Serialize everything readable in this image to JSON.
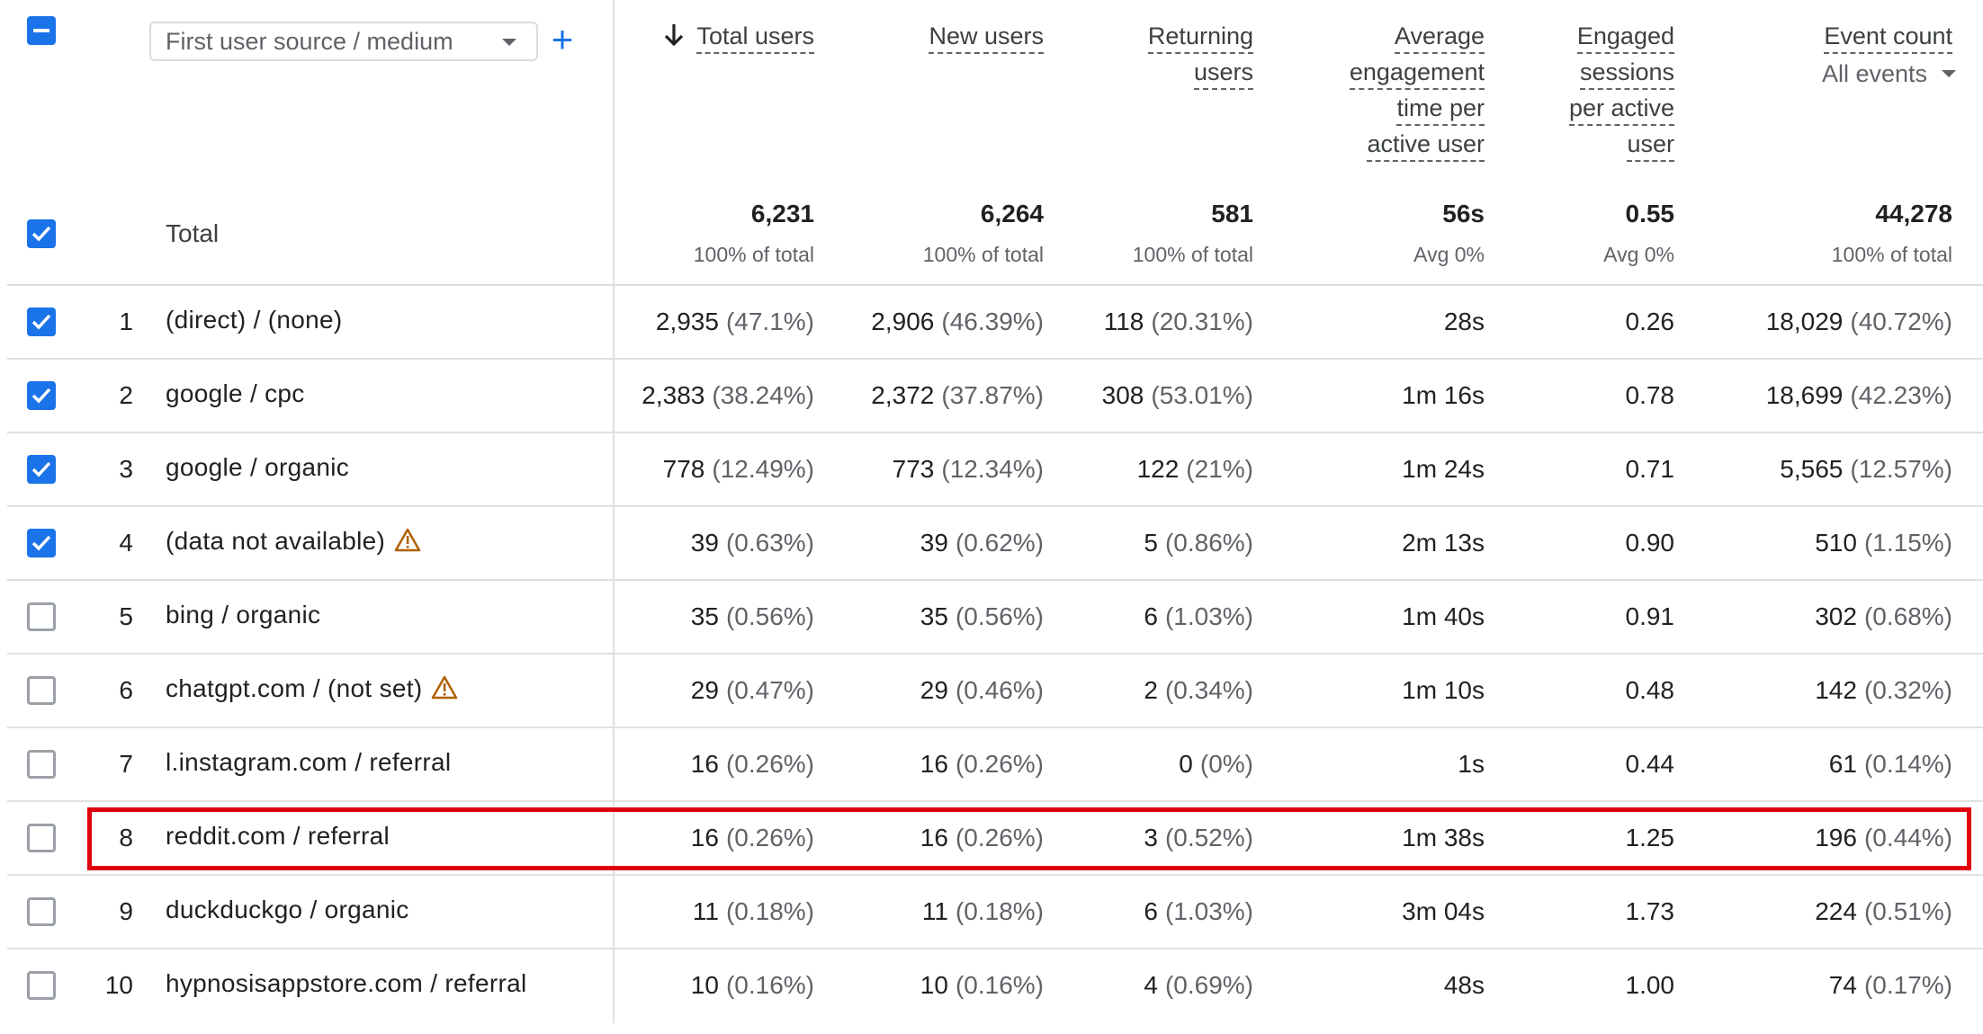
{
  "dimension": {
    "label": "First user source / medium"
  },
  "total_label": "Total",
  "columns": [
    {
      "key": "total_users",
      "lines": [
        "Total users"
      ],
      "sorted": true
    },
    {
      "key": "new_users",
      "lines": [
        "New users"
      ]
    },
    {
      "key": "returning_users",
      "lines": [
        "Returning",
        "users"
      ]
    },
    {
      "key": "avg_engagement",
      "lines": [
        "Average",
        "engagement",
        "time per",
        "active user"
      ]
    },
    {
      "key": "engaged_sessions",
      "lines": [
        "Engaged",
        "sessions",
        "per active",
        "user"
      ]
    },
    {
      "key": "event_count",
      "lines": [
        "Event count"
      ],
      "filter": "All events"
    }
  ],
  "totals": [
    {
      "value": "6,231",
      "sub": "100% of total"
    },
    {
      "value": "6,264",
      "sub": "100% of total"
    },
    {
      "value": "581",
      "sub": "100% of total"
    },
    {
      "value": "56s",
      "sub": "Avg 0%"
    },
    {
      "value": "0.55",
      "sub": "Avg 0%"
    },
    {
      "value": "44,278",
      "sub": "100% of total"
    }
  ],
  "rows": [
    {
      "num": "1",
      "name": "(direct) / (none)",
      "checked": true,
      "warn": false,
      "cells": [
        [
          "2,935",
          "(47.1%)"
        ],
        [
          "2,906",
          "(46.39%)"
        ],
        [
          "118",
          "(20.31%)"
        ],
        [
          "28s",
          ""
        ],
        [
          "0.26",
          ""
        ],
        [
          "18,029",
          "(40.72%)"
        ]
      ]
    },
    {
      "num": "2",
      "name": "google / cpc",
      "checked": true,
      "warn": false,
      "cells": [
        [
          "2,383",
          "(38.24%)"
        ],
        [
          "2,372",
          "(37.87%)"
        ],
        [
          "308",
          "(53.01%)"
        ],
        [
          "1m 16s",
          ""
        ],
        [
          "0.78",
          ""
        ],
        [
          "18,699",
          "(42.23%)"
        ]
      ]
    },
    {
      "num": "3",
      "name": "google / organic",
      "checked": true,
      "warn": false,
      "cells": [
        [
          "778",
          "(12.49%)"
        ],
        [
          "773",
          "(12.34%)"
        ],
        [
          "122",
          "(21%)"
        ],
        [
          "1m 24s",
          ""
        ],
        [
          "0.71",
          ""
        ],
        [
          "5,565",
          "(12.57%)"
        ]
      ]
    },
    {
      "num": "4",
      "name": "(data not available)",
      "checked": true,
      "warn": true,
      "cells": [
        [
          "39",
          "(0.63%)"
        ],
        [
          "39",
          "(0.62%)"
        ],
        [
          "5",
          "(0.86%)"
        ],
        [
          "2m 13s",
          ""
        ],
        [
          "0.90",
          ""
        ],
        [
          "510",
          "(1.15%)"
        ]
      ]
    },
    {
      "num": "5",
      "name": "bing / organic",
      "checked": false,
      "warn": false,
      "cells": [
        [
          "35",
          "(0.56%)"
        ],
        [
          "35",
          "(0.56%)"
        ],
        [
          "6",
          "(1.03%)"
        ],
        [
          "1m 40s",
          ""
        ],
        [
          "0.91",
          ""
        ],
        [
          "302",
          "(0.68%)"
        ]
      ]
    },
    {
      "num": "6",
      "name": "chatgpt.com / (not set)",
      "checked": false,
      "warn": true,
      "cells": [
        [
          "29",
          "(0.47%)"
        ],
        [
          "29",
          "(0.46%)"
        ],
        [
          "2",
          "(0.34%)"
        ],
        [
          "1m 10s",
          ""
        ],
        [
          "0.48",
          ""
        ],
        [
          "142",
          "(0.32%)"
        ]
      ]
    },
    {
      "num": "7",
      "name": "l.instagram.com / referral",
      "checked": false,
      "warn": false,
      "cells": [
        [
          "16",
          "(0.26%)"
        ],
        [
          "16",
          "(0.26%)"
        ],
        [
          "0",
          "(0%)"
        ],
        [
          "1s",
          ""
        ],
        [
          "0.44",
          ""
        ],
        [
          "61",
          "(0.14%)"
        ]
      ]
    },
    {
      "num": "8",
      "name": "reddit.com / referral",
      "checked": false,
      "warn": false,
      "highlighted": true,
      "cells": [
        [
          "16",
          "(0.26%)"
        ],
        [
          "16",
          "(0.26%)"
        ],
        [
          "3",
          "(0.52%)"
        ],
        [
          "1m 38s",
          ""
        ],
        [
          "1.25",
          ""
        ],
        [
          "196",
          "(0.44%)"
        ]
      ]
    },
    {
      "num": "9",
      "name": "duckduckgo / organic",
      "checked": false,
      "warn": false,
      "cells": [
        [
          "11",
          "(0.18%)"
        ],
        [
          "11",
          "(0.18%)"
        ],
        [
          "6",
          "(1.03%)"
        ],
        [
          "3m 04s",
          ""
        ],
        [
          "1.73",
          ""
        ],
        [
          "224",
          "(0.51%)"
        ]
      ]
    },
    {
      "num": "10",
      "name": "hypnosisappstore.com / referral",
      "checked": false,
      "warn": false,
      "cells": [
        [
          "10",
          "(0.16%)"
        ],
        [
          "10",
          "(0.16%)"
        ],
        [
          "4",
          "(0.69%)"
        ],
        [
          "48s",
          ""
        ],
        [
          "1.00",
          ""
        ],
        [
          "74",
          "(0.17%)"
        ]
      ]
    }
  ],
  "colors": {
    "accent": "#1a73e8",
    "highlight": "#e0000d",
    "warning": "#b06000"
  }
}
